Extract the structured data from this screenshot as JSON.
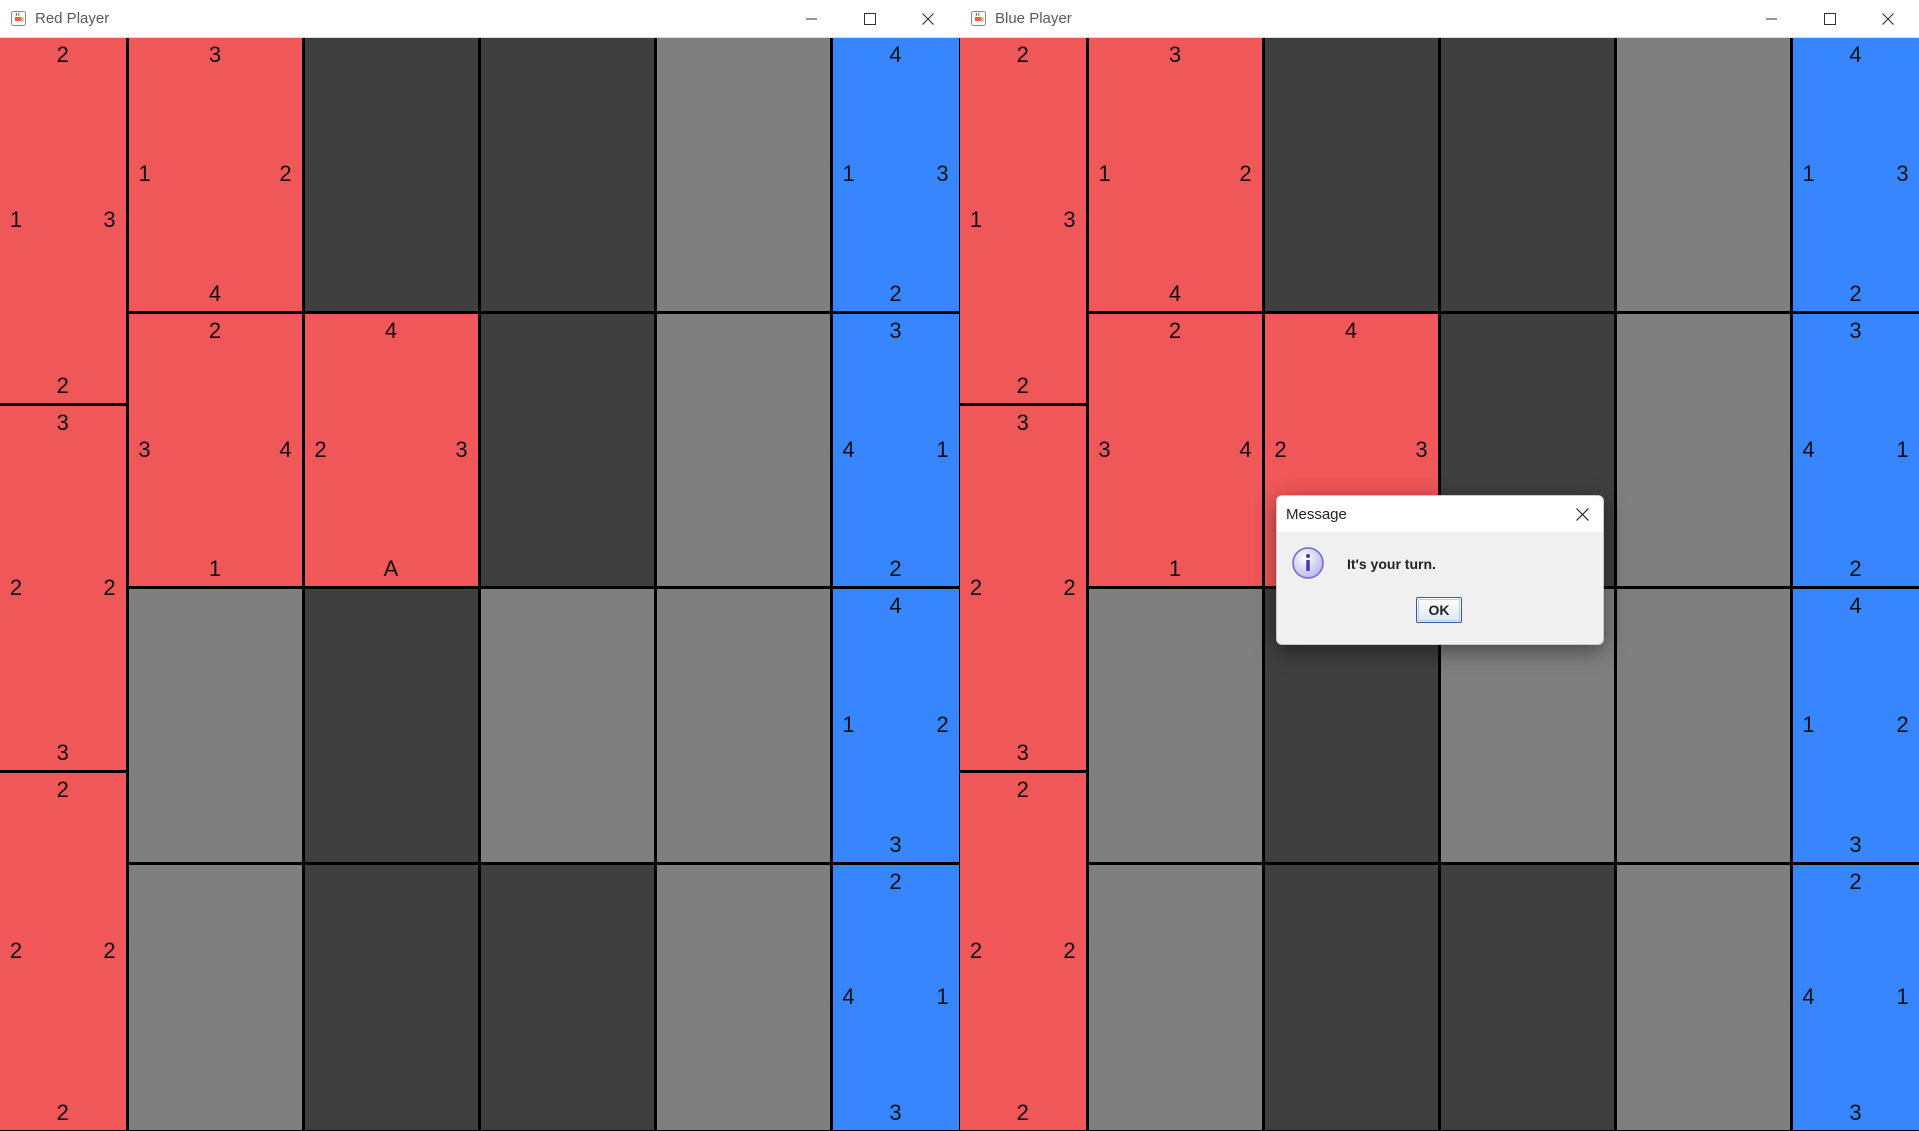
{
  "colors": {
    "red": "#ef5759",
    "blue": "#3786ff",
    "dark": "#3f3f3f",
    "light": "#7f7f7f"
  },
  "icons": {
    "app": "java-icon",
    "minimize": "minimize-icon",
    "maximize": "maximize-icon",
    "close": "close-icon",
    "info": "info-icon"
  },
  "windows": [
    {
      "title": "Red Player"
    },
    {
      "title": "Blue Player"
    }
  ],
  "board": {
    "left_column": [
      {
        "color": "red",
        "top": "2",
        "left": "1",
        "right": "3",
        "bottom": "2"
      },
      {
        "color": "red",
        "top": "3",
        "left": "2",
        "right": "2",
        "bottom": "3"
      },
      {
        "color": "red",
        "top": "2",
        "left": "2",
        "right": "2",
        "bottom": "2"
      }
    ],
    "right_column": [
      {
        "color": "blue",
        "top": "4",
        "left": "1",
        "right": "3",
        "bottom": "2"
      },
      {
        "color": "blue",
        "top": "3",
        "left": "4",
        "right": "1",
        "bottom": "2"
      },
      {
        "color": "blue",
        "top": "4",
        "left": "1",
        "right": "2",
        "bottom": "3"
      },
      {
        "color": "blue",
        "top": "2",
        "left": "4",
        "right": "1",
        "bottom": "3"
      }
    ],
    "grid": [
      [
        {
          "color": "red",
          "top": "3",
          "left": "1",
          "right": "2",
          "bottom": "4"
        },
        {
          "color": "dark"
        },
        {
          "color": "dark"
        },
        {
          "color": "light"
        }
      ],
      [
        {
          "color": "red",
          "top": "2",
          "left": "3",
          "right": "4",
          "bottom": "1"
        },
        {
          "color": "red",
          "top": "4",
          "left": "2",
          "right": "3",
          "bottom": "A"
        },
        {
          "color": "dark"
        },
        {
          "color": "light"
        }
      ],
      [
        {
          "color": "light"
        },
        {
          "color": "dark"
        },
        {
          "color": "light"
        },
        {
          "color": "light"
        }
      ],
      [
        {
          "color": "light"
        },
        {
          "color": "dark"
        },
        {
          "color": "dark"
        },
        {
          "color": "light"
        }
      ]
    ]
  },
  "dialog": {
    "title": "Message",
    "message": "It's your turn.",
    "ok_label": "OK"
  }
}
